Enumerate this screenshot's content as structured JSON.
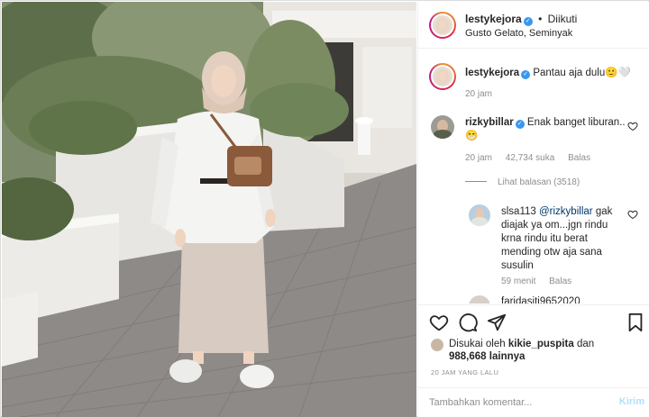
{
  "post": {
    "author": "lestykejora",
    "follow_state": "Diikuti",
    "separator": "•",
    "location": "Gusto Gelato, Seminyak"
  },
  "caption": {
    "user": "lestykejora",
    "text": "Pantau aja dulu🙂🤍",
    "time": "20 jam"
  },
  "comments": [
    {
      "user": "rizkybillar",
      "text": "Enak banget liburan..",
      "emoji": "😁",
      "time": "20 jam",
      "likes": "42,734 suka",
      "reply": "Balas",
      "view_replies": "Lihat balasan (3518)"
    },
    {
      "user": "slsa113",
      "mention": "@rizkybillar",
      "text": "gak diajak ya om...jgn rindu krna rindu itu berat mending otw aja sana susulin",
      "line1": "gak",
      "line2": "diajak ya om...jgn rindu",
      "line3": "krna rindu itu berat",
      "line4": "mending otw aja sana",
      "line5": "susulin",
      "time": "59 menit",
      "reply": "Balas"
    },
    {
      "user": "faridasiti9652020"
    }
  ],
  "likes": {
    "prefix": "Disukai oleh",
    "user": "kikie_puspita",
    "connector": "dan",
    "others_count": "988,668",
    "others_suffix": "lainnya"
  },
  "timestamp": "20 JAM YANG LALU",
  "comment_box": {
    "placeholder": "Tambahkan komentar...",
    "post_label": "Kirim"
  },
  "icons": {
    "like": "heart-icon",
    "comment": "comment-icon",
    "share": "share-icon",
    "save": "bookmark-icon",
    "verified": "verified-badge-icon"
  },
  "colors": {
    "verified": "#3897f0",
    "muted": "#8e8e8e",
    "link": "#00376b",
    "post_button": "#b2dffc"
  }
}
